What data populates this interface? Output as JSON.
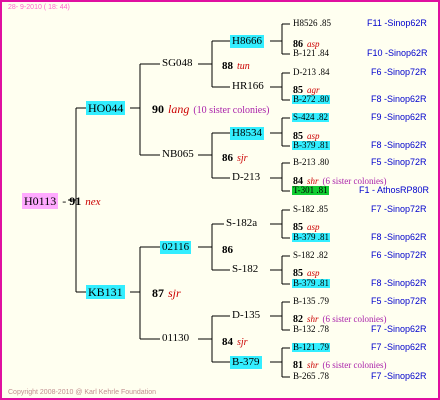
{
  "header": "28- 9-2010 ( 18: 44)",
  "copyright": "Copyright 2008-2010 @ Karl Kehrle Foundation",
  "colors": {
    "frame": "#e010a0",
    "background": "#fffff0",
    "root": "#ffaaff",
    "highlight": "#33eeff",
    "green": "#11cc33",
    "suffix": "#cc0000",
    "breeder": "#0000cc"
  },
  "root": {
    "id": "H0113",
    "score": "91",
    "suffix": "nex"
  },
  "gen1": [
    {
      "id": "HO044",
      "score": "90",
      "suffix": "lang",
      "note": "(10 sister colonies)"
    },
    {
      "id": "KB131",
      "score": "87",
      "suffix": "sjr"
    }
  ],
  "gen2": [
    {
      "id": "SG048",
      "score": "88",
      "suffix": "tun"
    },
    {
      "id": "NB065",
      "score": "86",
      "suffix": "sjr"
    },
    {
      "id": "02116",
      "score": "86",
      "suffix": ""
    },
    {
      "id": "01130",
      "score": "84",
      "suffix": "sjr"
    }
  ],
  "gen3": [
    {
      "id": "H8666",
      "score": "86",
      "suffix": "asp"
    },
    {
      "id": "HR166",
      "score": "85",
      "suffix": "agr"
    },
    {
      "id": "H8534",
      "score": "85",
      "suffix": "asp"
    },
    {
      "id": "D-213",
      "score": "84",
      "suffix": "shr",
      "note": "(6 sister colonies)"
    },
    {
      "id": "S-182a",
      "score": "85",
      "suffix": "asp"
    },
    {
      "id": "S-182",
      "score": "85",
      "suffix": "asp"
    },
    {
      "id": "D-135",
      "score": "82",
      "suffix": "shr",
      "note": "(6 sister colonies)"
    },
    {
      "id": "B-379",
      "score": "81",
      "suffix": "shr",
      "note": "(6 sister colonies)"
    }
  ],
  "gen4": [
    {
      "id": "H8526",
      "score": ".85",
      "breeder": "F11 -Sinop62R"
    },
    {
      "id": "B-121",
      "score": ".84",
      "breeder": "F10 -Sinop62R"
    },
    {
      "id": "D-213",
      "score": ".84",
      "breeder": "F6 -Sinop72R"
    },
    {
      "id": "B-272",
      "score": ".80",
      "breeder": "F8 -Sinop62R"
    },
    {
      "id": "S-424",
      "score": ".82",
      "breeder": "F9 -Sinop62R"
    },
    {
      "id": "B-379",
      "score": ".81",
      "breeder": "F8 -Sinop62R"
    },
    {
      "id": "B-213",
      "score": ".80",
      "breeder": "F5 -Sinop72R"
    },
    {
      "id": "T-301",
      "score": ".81",
      "breeder": "F1 - AthosRP80R"
    },
    {
      "id": "S-182",
      "score": ".85",
      "breeder": "F7 -Sinop72R"
    },
    {
      "id": "B-379",
      "score": ".81",
      "breeder": "F8 -Sinop62R"
    },
    {
      "id": "S-182",
      "score": ".82",
      "breeder": "F6 -Sinop72R"
    },
    {
      "id": "B-379",
      "score": ".81",
      "breeder": "F8 -Sinop62R"
    },
    {
      "id": "B-135",
      "score": ".79",
      "breeder": "F5 -Sinop72R"
    },
    {
      "id": "B-132",
      "score": ".78",
      "breeder": "F7 -Sinop62R"
    },
    {
      "id": "B-121",
      "score": ".79",
      "breeder": "F7 -Sinop62R"
    },
    {
      "id": "B-265",
      "score": ".78",
      "breeder": "F7 -Sinop62R"
    }
  ]
}
